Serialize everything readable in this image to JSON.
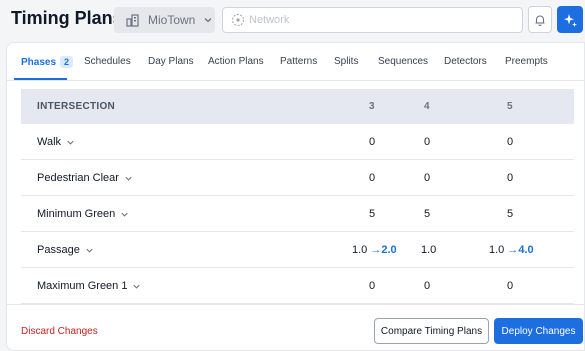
{
  "header": {
    "title": "Timing Plans",
    "city_select": {
      "value": "MioTown",
      "icon": "building-icon"
    },
    "network_search": {
      "placeholder": "Network",
      "value": ""
    }
  },
  "tabs": [
    {
      "label": "Phases",
      "badge": "2",
      "active": true
    },
    {
      "label": "Schedules"
    },
    {
      "label": "Day Plans"
    },
    {
      "label": "Action Plans"
    },
    {
      "label": "Patterns"
    },
    {
      "label": "Splits"
    },
    {
      "label": "Sequences"
    },
    {
      "label": "Detectors"
    },
    {
      "label": "Preempts"
    }
  ],
  "table": {
    "header": {
      "name": "INTERSECTION",
      "columns": [
        "3",
        "4",
        "5"
      ]
    },
    "rows": [
      {
        "name": "Walk",
        "c3": "0",
        "c4": "0",
        "c5": "0"
      },
      {
        "name": "Pedestrian Clear",
        "c3": "0",
        "c4": "0",
        "c5": "0"
      },
      {
        "name": "Minimum Green",
        "c3": "5",
        "c4": "5",
        "c5": "5"
      },
      {
        "name": "Passage",
        "c3": "1.0",
        "c3_new": "→2.0",
        "c4": "1.0",
        "c5": "1.0",
        "c5_new": "→4.0"
      },
      {
        "name": "Maximum Green 1",
        "c3": "0",
        "c4": "0",
        "c5": "0"
      }
    ]
  },
  "footer": {
    "discard_label": "Discard Changes",
    "compare_label": "Compare Timing Plans",
    "deploy_label": "Deploy Changes"
  },
  "colors": {
    "accent": "#1d6fe0",
    "danger": "#c81e1e",
    "header_bg": "#e5e8f0"
  }
}
